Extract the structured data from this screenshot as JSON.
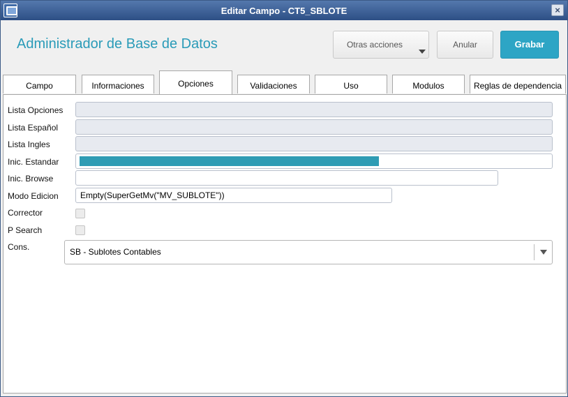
{
  "window": {
    "title": "Editar Campo - CT5_SBLOTE"
  },
  "header": {
    "title": "Administrador de Base de Datos",
    "buttons": {
      "otras": "Otras acciones",
      "anular": "Anular",
      "grabar": "Grabar"
    }
  },
  "tabs": [
    "Campo",
    "Informaciones",
    "Opciones",
    "Validaciones",
    "Uso",
    "Modulos",
    "Reglas de dependencia"
  ],
  "active_tab": "Opciones",
  "form": {
    "lista_opciones": {
      "label": "Lista Opciones",
      "value": ""
    },
    "lista_espanol": {
      "label": "Lista Español",
      "value": ""
    },
    "lista_ingles": {
      "label": "Lista Ingles",
      "value": ""
    },
    "inic_estandar": {
      "label": "Inic. Estandar",
      "value": ""
    },
    "inic_browse": {
      "label": "Inic. Browse",
      "value": ""
    },
    "modo_edicion": {
      "label": "Modo Edicion",
      "value": "Empty(SuperGetMv(\"MV_SUBLOTE\"))"
    },
    "corrector": {
      "label": "Corrector",
      "checked": false
    },
    "p_search": {
      "label": "P Search",
      "checked": false
    },
    "cons": {
      "label": "Cons.",
      "value": "SB - Sublotes Contables"
    }
  },
  "colors": {
    "accent": "#2da5c5",
    "title_bar": "#3a5f96",
    "highlight": "#2f9cb4"
  }
}
